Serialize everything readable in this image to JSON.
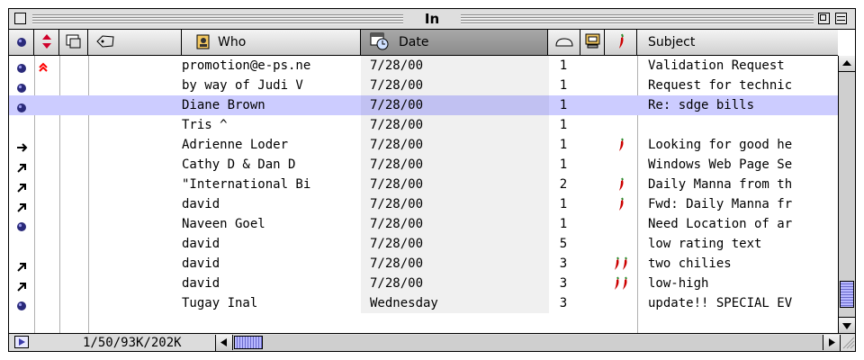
{
  "window": {
    "title": "In"
  },
  "columns": {
    "who": "Who",
    "date": "Date",
    "subject": "Subject"
  },
  "rows": [
    {
      "status": "unread",
      "priority": "high",
      "who": "promotion@e-ps.ne",
      "date": "7/28/00",
      "size": "1",
      "spicy": 0,
      "subject": "Validation Request"
    },
    {
      "status": "unread",
      "priority": "",
      "who": "by way of Judi V",
      "date": "7/28/00",
      "size": "1",
      "spicy": 0,
      "subject": "Request for technic"
    },
    {
      "status": "unread",
      "priority": "",
      "who": "Diane Brown",
      "date": "7/28/00",
      "size": "1",
      "spicy": 0,
      "subject": "Re: sdge bills",
      "selected": true
    },
    {
      "status": "",
      "priority": "",
      "who": "Tris ^",
      "date": "7/28/00",
      "size": "1",
      "spicy": 0,
      "subject": ""
    },
    {
      "status": "forwarded",
      "priority": "",
      "who": "Adrienne Loder",
      "date": "7/28/00",
      "size": "1",
      "spicy": 1,
      "subject": "Looking for good he"
    },
    {
      "status": "redirected",
      "priority": "",
      "who": "Cathy D & Dan D",
      "date": "7/28/00",
      "size": "1",
      "spicy": 0,
      "subject": "Windows Web Page Se"
    },
    {
      "status": "redirected",
      "priority": "",
      "who": "\"International Bi",
      "date": "7/28/00",
      "size": "2",
      "spicy": 1,
      "subject": "Daily Manna from th"
    },
    {
      "status": "redirected",
      "priority": "",
      "who": "david",
      "date": "7/28/00",
      "size": "1",
      "spicy": 1,
      "subject": "Fwd: Daily Manna fr"
    },
    {
      "status": "unread",
      "priority": "",
      "who": "Naveen Goel",
      "date": "7/28/00",
      "size": "1",
      "spicy": 0,
      "subject": "Need Location of ar"
    },
    {
      "status": "",
      "priority": "",
      "who": "david",
      "date": "7/28/00",
      "size": "5",
      "spicy": 0,
      "subject": "low rating text"
    },
    {
      "status": "redirected",
      "priority": "",
      "who": "david",
      "date": "7/28/00",
      "size": "3",
      "spicy": 2,
      "subject": "two chilies"
    },
    {
      "status": "redirected",
      "priority": "",
      "who": "david",
      "date": "7/28/00",
      "size": "3",
      "spicy": 2,
      "subject": "low-high"
    },
    {
      "status": "unread",
      "priority": "",
      "who": "Tugay Inal",
      "date": "Wednesday",
      "size": "3",
      "spicy": 0,
      "subject": "update!! SPECIAL EV"
    }
  ],
  "footer": {
    "counts": "1/50/93K/202K"
  },
  "colors": {
    "selection": "#ccccff",
    "chili": "#cc0000",
    "priority": "#ff0000",
    "thumb": "#b8b8ff"
  },
  "icons": {
    "unread": "blue-dot-icon",
    "forwarded": "right-arrow-icon",
    "redirected": "diagonal-arrow-icon",
    "priority-high": "double-up-chevron-icon",
    "spicy": "chili-pepper-icon"
  }
}
